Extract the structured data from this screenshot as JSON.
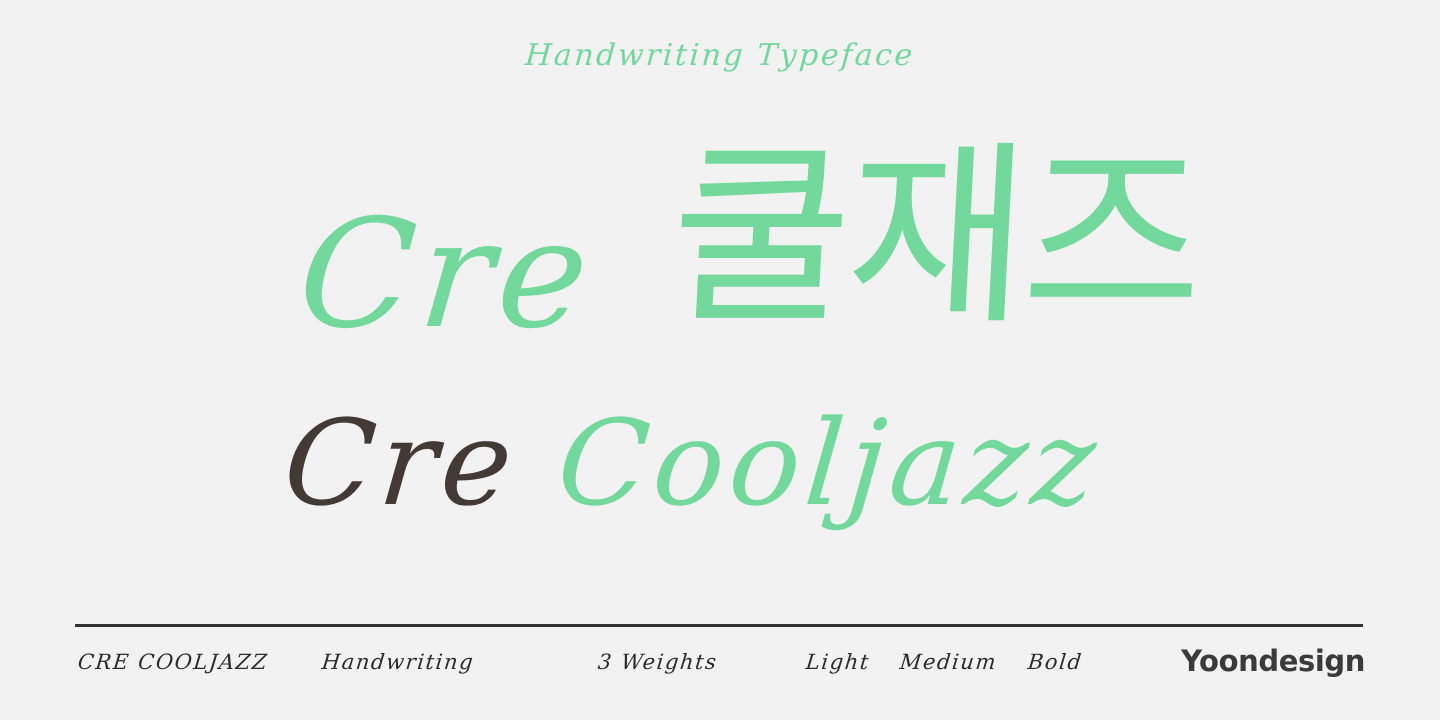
{
  "poster": {
    "background_color": "#f2f2f2",
    "accent_color": "#73d89b",
    "dark_color": "#433a36",
    "kicker": "Handwriting Typeface"
  },
  "headline": {
    "line1_latin": "Cre",
    "line1_hangul": "쿨재즈",
    "line2_dark": "Cre",
    "line2_green": "Cooljazz"
  },
  "footer": {
    "font_name": "CRE COOLJAZZ",
    "category": "Handwriting",
    "weight_count": "3 Weights",
    "weight_light": "Light",
    "weight_medium": "Medium",
    "weight_bold": "Bold",
    "brand": "Yoondesign"
  }
}
